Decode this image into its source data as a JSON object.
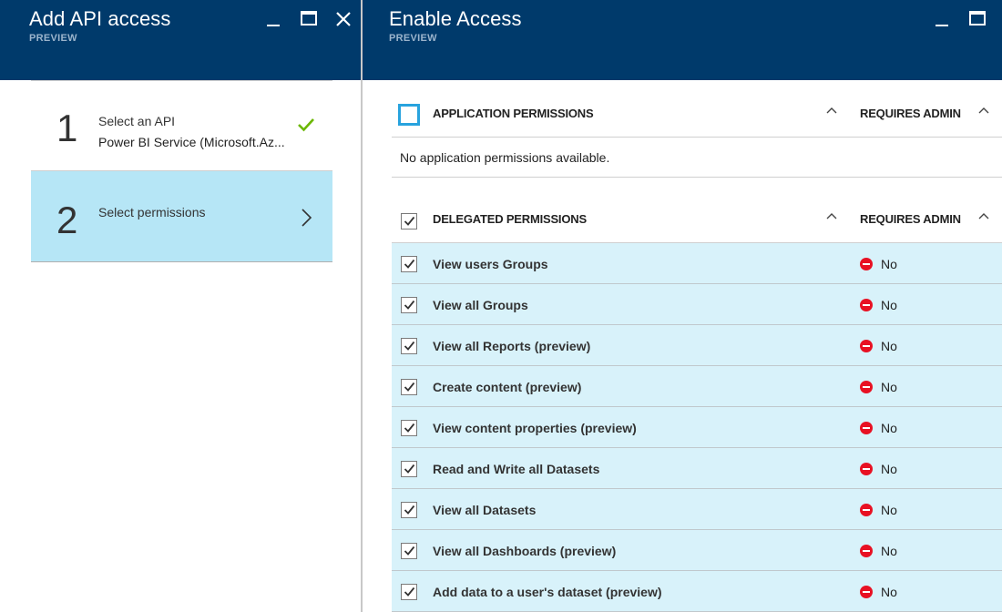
{
  "left_blade": {
    "title": "Add API access",
    "subtitle": "PREVIEW",
    "steps": [
      {
        "number": "1",
        "label": "Select an API",
        "value": "Power BI Service (Microsoft.Az..."
      },
      {
        "number": "2",
        "label": "Select permissions"
      }
    ]
  },
  "right_blade": {
    "title": "Enable Access",
    "subtitle": "PREVIEW",
    "application_section": {
      "title": "APPLICATION PERMISSIONS",
      "admin_header": "REQUIRES ADMIN",
      "empty_message": "No application permissions available."
    },
    "delegated_section": {
      "title": "DELEGATED PERMISSIONS",
      "admin_header": "REQUIRES ADMIN",
      "permissions": [
        {
          "name": "View users Groups",
          "requires_admin": "No",
          "checked": true
        },
        {
          "name": "View all Groups",
          "requires_admin": "No",
          "checked": true
        },
        {
          "name": "View all Reports (preview)",
          "requires_admin": "No",
          "checked": true
        },
        {
          "name": "Create content (preview)",
          "requires_admin": "No",
          "checked": true
        },
        {
          "name": "View content properties (preview)",
          "requires_admin": "No",
          "checked": true
        },
        {
          "name": "Read and Write all Datasets",
          "requires_admin": "No",
          "checked": true
        },
        {
          "name": "View all Datasets",
          "requires_admin": "No",
          "checked": true
        },
        {
          "name": "View all Dashboards (preview)",
          "requires_admin": "No",
          "checked": true
        },
        {
          "name": "Add data to a user's dataset (preview)",
          "requires_admin": "No",
          "checked": true
        }
      ]
    }
  },
  "colors": {
    "header_bg": "#003a6b",
    "selected_step_bg": "#b6e6f6",
    "row_bg": "#d8f2fa",
    "check_green": "#6bb700",
    "stop_red": "#e81123",
    "accent_blue": "#28a3de"
  },
  "icons": {
    "minimize": "minimize-icon",
    "maximize": "maximize-icon",
    "close": "close-icon",
    "step_done": "checkmark-icon",
    "step_next": "chevron-right-icon",
    "section_toggle": "chevron-up-icon",
    "admin_required": "stop-icon"
  }
}
